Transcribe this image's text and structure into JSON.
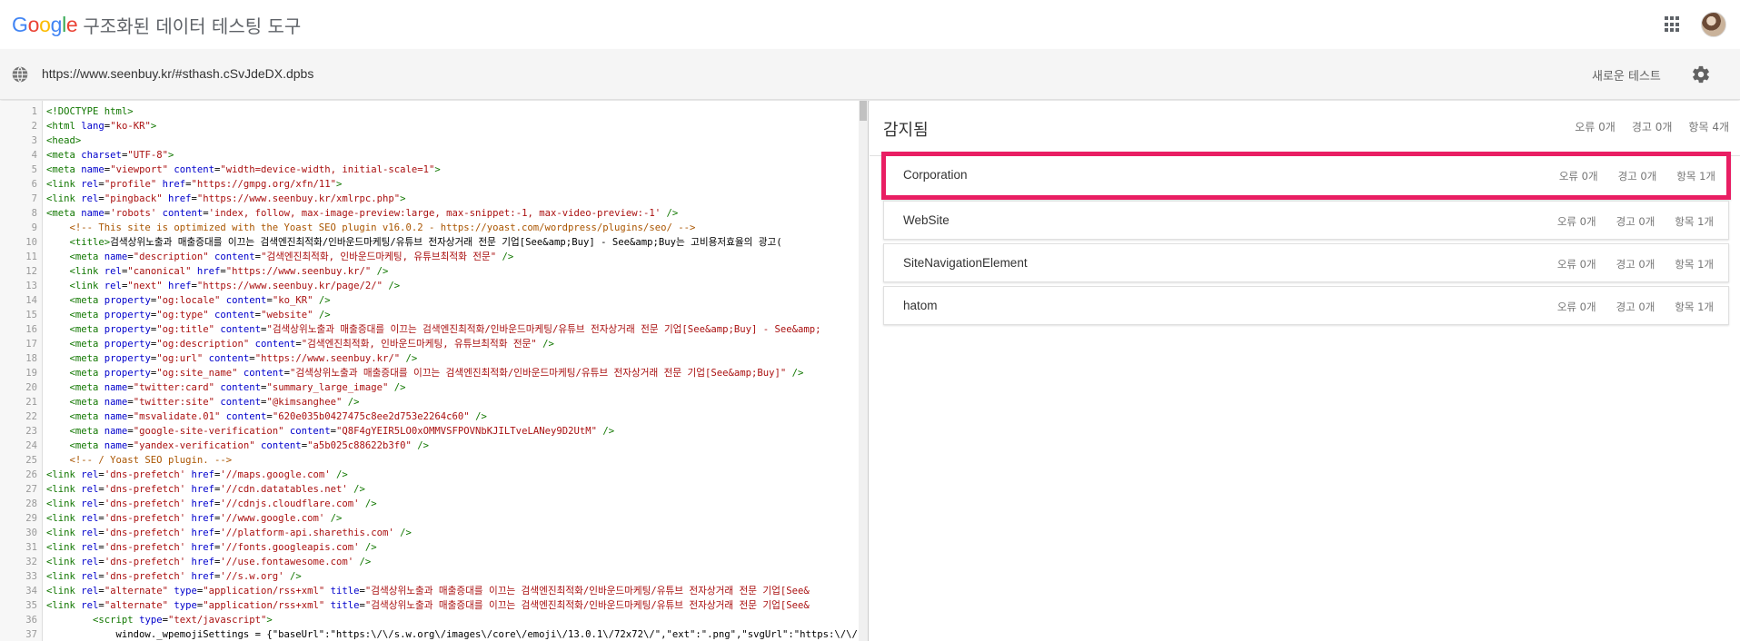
{
  "header": {
    "logo_letters": [
      {
        "ch": "G",
        "color": "#4285F4"
      },
      {
        "ch": "o",
        "color": "#EA4335"
      },
      {
        "ch": "o",
        "color": "#FBBC05"
      },
      {
        "ch": "g",
        "color": "#4285F4"
      },
      {
        "ch": "l",
        "color": "#34A853"
      },
      {
        "ch": "e",
        "color": "#EA4335"
      }
    ],
    "app_title": "구조화된 데이터 테스팅 도구"
  },
  "url_bar": {
    "url": "https://www.seenbuy.kr/#sthash.cSvJdeDX.dpbs",
    "new_test_label": "새로운 테스트"
  },
  "code_lines": [
    {
      "n": "1",
      "html": "<span class='t'>&lt;!DOCTYPE html&gt;</span>"
    },
    {
      "n": "2",
      "html": "<span class='t'>&lt;html</span> <span class='a'>lang</span><span class='p'>=</span><span class='s'>\"ko-KR\"</span><span class='t'>&gt;</span>"
    },
    {
      "n": "3",
      "html": "<span class='t'>&lt;head&gt;</span>"
    },
    {
      "n": "4",
      "html": "<span class='t'>&lt;meta</span> <span class='a'>charset</span><span class='p'>=</span><span class='s'>\"UTF-8\"</span><span class='t'>&gt;</span>"
    },
    {
      "n": "5",
      "html": "<span class='t'>&lt;meta</span> <span class='a'>name</span><span class='p'>=</span><span class='s'>\"viewport\"</span> <span class='a'>content</span><span class='p'>=</span><span class='s'>\"width=device-width, initial-scale=1\"</span><span class='t'>&gt;</span>"
    },
    {
      "n": "6",
      "html": "<span class='t'>&lt;link</span> <span class='a'>rel</span><span class='p'>=</span><span class='s'>\"profile\"</span> <span class='a'>href</span><span class='p'>=</span><span class='s'>\"https://gmpg.org/xfn/11\"</span><span class='t'>&gt;</span>"
    },
    {
      "n": "7",
      "html": "<span class='t'>&lt;link</span> <span class='a'>rel</span><span class='p'>=</span><span class='s'>\"pingback\"</span> <span class='a'>href</span><span class='p'>=</span><span class='s'>\"https://www.seenbuy.kr/xmlrpc.php\"</span><span class='t'>&gt;</span>"
    },
    {
      "n": "8",
      "html": "<span class='t'>&lt;meta</span> <span class='a'>name</span><span class='p'>=</span><span class='s'>'robots'</span> <span class='a'>content</span><span class='p'>=</span><span class='s'>'index, follow, max-image-preview:large, max-snippet:-1, max-video-preview:-1'</span> <span class='t'>/&gt;</span>"
    },
    {
      "n": "9",
      "html": "    <span class='c'>&lt;!-- This site is optimized with the Yoast SEO plugin v16.0.2 - https://yoast.com/wordpress/plugins/seo/ --&gt;</span>"
    },
    {
      "n": "10",
      "html": "    <span class='t'>&lt;title&gt;</span><span class='p'>검색상위노출과 매출증대를 이끄는 검색엔진최적화/인바운드마케팅/유튜브 전자상거래 전문 기업[See&amp;amp;Buy] - See&amp;amp;Buy는 고비용저효율의 광고(</span>"
    },
    {
      "n": "11",
      "html": "    <span class='t'>&lt;meta</span> <span class='a'>name</span><span class='p'>=</span><span class='s'>\"description\"</span> <span class='a'>content</span><span class='p'>=</span><span class='s'>\"검색엔진최적화, 인바운드마케팅, 유튜브최적화 전문\"</span> <span class='t'>/&gt;</span>"
    },
    {
      "n": "12",
      "html": "    <span class='t'>&lt;link</span> <span class='a'>rel</span><span class='p'>=</span><span class='s'>\"canonical\"</span> <span class='a'>href</span><span class='p'>=</span><span class='s'>\"https://www.seenbuy.kr/\"</span> <span class='t'>/&gt;</span>"
    },
    {
      "n": "13",
      "html": "    <span class='t'>&lt;link</span> <span class='a'>rel</span><span class='p'>=</span><span class='s'>\"next\"</span> <span class='a'>href</span><span class='p'>=</span><span class='s'>\"https://www.seenbuy.kr/page/2/\"</span> <span class='t'>/&gt;</span>"
    },
    {
      "n": "14",
      "html": "    <span class='t'>&lt;meta</span> <span class='a'>property</span><span class='p'>=</span><span class='s'>\"og:locale\"</span> <span class='a'>content</span><span class='p'>=</span><span class='s'>\"ko_KR\"</span> <span class='t'>/&gt;</span>"
    },
    {
      "n": "15",
      "html": "    <span class='t'>&lt;meta</span> <span class='a'>property</span><span class='p'>=</span><span class='s'>\"og:type\"</span> <span class='a'>content</span><span class='p'>=</span><span class='s'>\"website\"</span> <span class='t'>/&gt;</span>"
    },
    {
      "n": "16",
      "html": "    <span class='t'>&lt;meta</span> <span class='a'>property</span><span class='p'>=</span><span class='s'>\"og:title\"</span> <span class='a'>content</span><span class='p'>=</span><span class='s'>\"검색상위노출과 매출증대를 이끄는 검색엔진최적화/인바운드마케팅/유튜브 전자상거래 전문 기업[See&amp;amp;Buy] - See&amp;amp;</span>"
    },
    {
      "n": "17",
      "html": "    <span class='t'>&lt;meta</span> <span class='a'>property</span><span class='p'>=</span><span class='s'>\"og:description\"</span> <span class='a'>content</span><span class='p'>=</span><span class='s'>\"검색엔진최적화, 인바운드마케팅, 유튜브최적화 전문\"</span> <span class='t'>/&gt;</span>"
    },
    {
      "n": "18",
      "html": "    <span class='t'>&lt;meta</span> <span class='a'>property</span><span class='p'>=</span><span class='s'>\"og:url\"</span> <span class='a'>content</span><span class='p'>=</span><span class='s'>\"https://www.seenbuy.kr/\"</span> <span class='t'>/&gt;</span>"
    },
    {
      "n": "19",
      "html": "    <span class='t'>&lt;meta</span> <span class='a'>property</span><span class='p'>=</span><span class='s'>\"og:site_name\"</span> <span class='a'>content</span><span class='p'>=</span><span class='s'>\"검색상위노출과 매출증대를 이끄는 검색엔진최적화/인바운드마케팅/유튜브 전자상거래 전문 기업[See&amp;amp;Buy]\"</span> <span class='t'>/&gt;</span>"
    },
    {
      "n": "20",
      "html": "    <span class='t'>&lt;meta</span> <span class='a'>name</span><span class='p'>=</span><span class='s'>\"twitter:card\"</span> <span class='a'>content</span><span class='p'>=</span><span class='s'>\"summary_large_image\"</span> <span class='t'>/&gt;</span>"
    },
    {
      "n": "21",
      "html": "    <span class='t'>&lt;meta</span> <span class='a'>name</span><span class='p'>=</span><span class='s'>\"twitter:site\"</span> <span class='a'>content</span><span class='p'>=</span><span class='s'>\"@kimsanghee\"</span> <span class='t'>/&gt;</span>"
    },
    {
      "n": "22",
      "html": "    <span class='t'>&lt;meta</span> <span class='a'>name</span><span class='p'>=</span><span class='s'>\"msvalidate.01\"</span> <span class='a'>content</span><span class='p'>=</span><span class='s'>\"620e035b0427475c8ee2d753e2264c60\"</span> <span class='t'>/&gt;</span>"
    },
    {
      "n": "23",
      "html": "    <span class='t'>&lt;meta</span> <span class='a'>name</span><span class='p'>=</span><span class='s'>\"google-site-verification\"</span> <span class='a'>content</span><span class='p'>=</span><span class='s'>\"Q8F4gYEIR5LO0xOMMVSFPOVNbKJILTveLANey9D2UtM\"</span> <span class='t'>/&gt;</span>"
    },
    {
      "n": "24",
      "html": "    <span class='t'>&lt;meta</span> <span class='a'>name</span><span class='p'>=</span><span class='s'>\"yandex-verification\"</span> <span class='a'>content</span><span class='p'>=</span><span class='s'>\"a5b025c88622b3f0\"</span> <span class='t'>/&gt;</span>"
    },
    {
      "n": "25",
      "html": "    <span class='c'>&lt;!-- / Yoast SEO plugin. --&gt;</span>"
    },
    {
      "n": "26",
      "html": "<span class='t'>&lt;link</span> <span class='a'>rel</span><span class='p'>=</span><span class='s'>'dns-prefetch'</span> <span class='a'>href</span><span class='p'>=</span><span class='s'>'//maps.google.com'</span> <span class='t'>/&gt;</span>"
    },
    {
      "n": "27",
      "html": "<span class='t'>&lt;link</span> <span class='a'>rel</span><span class='p'>=</span><span class='s'>'dns-prefetch'</span> <span class='a'>href</span><span class='p'>=</span><span class='s'>'//cdn.datatables.net'</span> <span class='t'>/&gt;</span>"
    },
    {
      "n": "28",
      "html": "<span class='t'>&lt;link</span> <span class='a'>rel</span><span class='p'>=</span><span class='s'>'dns-prefetch'</span> <span class='a'>href</span><span class='p'>=</span><span class='s'>'//cdnjs.cloudflare.com'</span> <span class='t'>/&gt;</span>"
    },
    {
      "n": "29",
      "html": "<span class='t'>&lt;link</span> <span class='a'>rel</span><span class='p'>=</span><span class='s'>'dns-prefetch'</span> <span class='a'>href</span><span class='p'>=</span><span class='s'>'//www.google.com'</span> <span class='t'>/&gt;</span>"
    },
    {
      "n": "30",
      "html": "<span class='t'>&lt;link</span> <span class='a'>rel</span><span class='p'>=</span><span class='s'>'dns-prefetch'</span> <span class='a'>href</span><span class='p'>=</span><span class='s'>'//platform-api.sharethis.com'</span> <span class='t'>/&gt;</span>"
    },
    {
      "n": "31",
      "html": "<span class='t'>&lt;link</span> <span class='a'>rel</span><span class='p'>=</span><span class='s'>'dns-prefetch'</span> <span class='a'>href</span><span class='p'>=</span><span class='s'>'//fonts.googleapis.com'</span> <span class='t'>/&gt;</span>"
    },
    {
      "n": "32",
      "html": "<span class='t'>&lt;link</span> <span class='a'>rel</span><span class='p'>=</span><span class='s'>'dns-prefetch'</span> <span class='a'>href</span><span class='p'>=</span><span class='s'>'//use.fontawesome.com'</span> <span class='t'>/&gt;</span>"
    },
    {
      "n": "33",
      "html": "<span class='t'>&lt;link</span> <span class='a'>rel</span><span class='p'>=</span><span class='s'>'dns-prefetch'</span> <span class='a'>href</span><span class='p'>=</span><span class='s'>'//s.w.org'</span> <span class='t'>/&gt;</span>"
    },
    {
      "n": "34",
      "html": "<span class='t'>&lt;link</span> <span class='a'>rel</span><span class='p'>=</span><span class='s'>\"alternate\"</span> <span class='a'>type</span><span class='p'>=</span><span class='s'>\"application/rss+xml\"</span> <span class='a'>title</span><span class='p'>=</span><span class='s'>\"검색상위노출과 매출증대를 이끄는 검색엔진최적화/인바운드마케팅/유튜브 전자상거래 전문 기업[See&amp;</span>"
    },
    {
      "n": "35",
      "html": "<span class='t'>&lt;link</span> <span class='a'>rel</span><span class='p'>=</span><span class='s'>\"alternate\"</span> <span class='a'>type</span><span class='p'>=</span><span class='s'>\"application/rss+xml\"</span> <span class='a'>title</span><span class='p'>=</span><span class='s'>\"검색상위노출과 매출증대를 이끄는 검색엔진최적화/인바운드마케팅/유튜브 전자상거래 전문 기업[See&amp;</span>"
    },
    {
      "n": "36",
      "html": "        <span class='t'>&lt;script</span> <span class='a'>type</span><span class='p'>=</span><span class='s'>\"text/javascript\"</span><span class='t'>&gt;</span>"
    },
    {
      "n": "37",
      "html": "            <span class='p'>window._wpemojiSettings = {\"baseUrl\":\"https:\\/\\/s.w.org\\/images\\/core\\/emoji\\/13.0.1\\/72x72\\/\",\"ext\":\".png\",\"svgUrl\":\"https:\\/\\/s.w.org\\/ima</span>"
    }
  ],
  "results": {
    "title": "감지됨",
    "summary": {
      "errors": "오류 0개",
      "warnings": "경고 0개",
      "items": "항목 4개"
    },
    "cards": [
      {
        "name": "Corporation",
        "errors": "오류 0개",
        "warnings": "경고 0개",
        "items": "항목 1개",
        "selected": true
      },
      {
        "name": "WebSite",
        "errors": "오류 0개",
        "warnings": "경고 0개",
        "items": "항목 1개",
        "selected": false
      },
      {
        "name": "SiteNavigationElement",
        "errors": "오류 0개",
        "warnings": "경고 0개",
        "items": "항목 1개",
        "selected": false
      },
      {
        "name": "hatom",
        "errors": "오류 0개",
        "warnings": "경고 0개",
        "items": "항목 1개",
        "selected": false
      }
    ]
  },
  "colors": {
    "selected_border": "#e91e63"
  },
  "icons": [
    "apps-grid-icon",
    "avatar",
    "globe-icon",
    "gear-icon"
  ]
}
